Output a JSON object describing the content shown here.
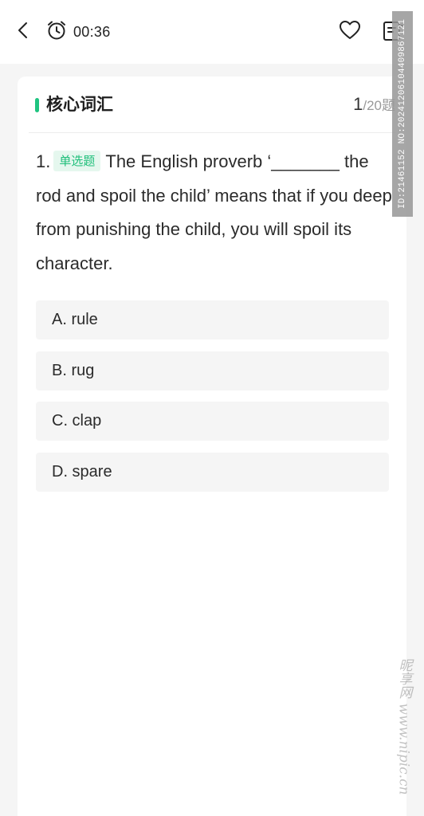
{
  "header": {
    "timer": "00:36",
    "icons": {
      "back": "chevron-left-icon",
      "timer": "alarm-clock-icon",
      "favorite": "heart-icon",
      "answer_sheet": "answer-sheet-icon"
    }
  },
  "section": {
    "title": "核心词汇",
    "current": "1",
    "total": "/20题",
    "accent_color": "#1fc480"
  },
  "question": {
    "number": "1.",
    "type_tag": "单选题",
    "text": "The English proverb ‘_______ the rod and spoil the child’ means that if you deep from punishing the child, you will spoil its character.",
    "tag_color": "#1fbf7a"
  },
  "options": [
    {
      "label": "A. rule"
    },
    {
      "label": "B. rug"
    },
    {
      "label": "C. clap"
    },
    {
      "label": "D. spare"
    }
  ],
  "watermark": {
    "id_text": "ID:21461152 NO:20241206104409867121",
    "site_text": "昵享网 www.nipic.cn"
  }
}
